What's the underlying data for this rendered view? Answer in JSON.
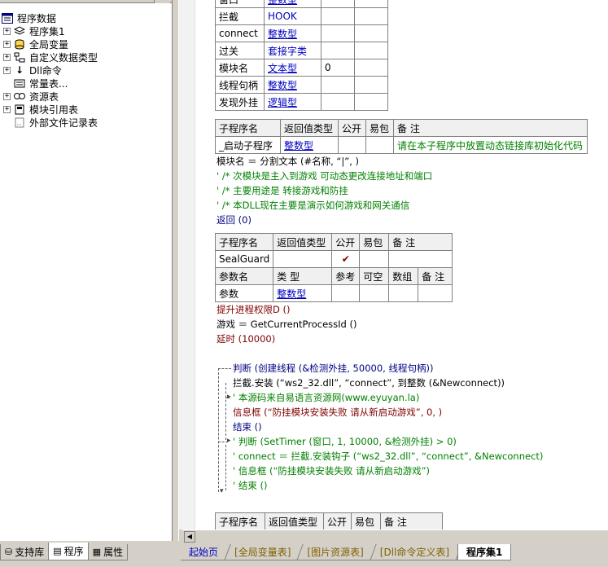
{
  "left_tree": {
    "root": "程序数据",
    "items": [
      {
        "label": "程序集1",
        "icon": "assembly-icon"
      },
      {
        "label": "全局变量",
        "icon": "global-var-icon"
      },
      {
        "label": "自定义数据类型",
        "icon": "datatype-icon"
      },
      {
        "label": "Dll命令",
        "icon": "dll-icon"
      },
      {
        "label": "常量表...",
        "icon": "constant-icon"
      },
      {
        "label": "资源表",
        "icon": "resource-icon"
      },
      {
        "label": "模块引用表",
        "icon": "module-icon"
      },
      {
        "label": "外部文件记录表",
        "icon": "file-icon"
      }
    ]
  },
  "left_tabs": [
    "支持库",
    "程序",
    "属性"
  ],
  "var_table": [
    {
      "name": "窗口",
      "type": "整数型",
      "val": ""
    },
    {
      "name": "拦截",
      "type": "HOOK",
      "val": ""
    },
    {
      "name": "connect",
      "type": "整数型",
      "val": ""
    },
    {
      "name": "过关",
      "type": "套接字类",
      "val": ""
    },
    {
      "name": "模块名",
      "type": "文本型",
      "val": "0"
    },
    {
      "name": "线程句柄",
      "type": "整数型",
      "val": ""
    },
    {
      "name": "发现外挂",
      "type": "逻辑型",
      "val": ""
    }
  ],
  "sub1": {
    "headers": [
      "子程序名",
      "返回值类型",
      "公开",
      "易包",
      "备 注"
    ],
    "name": "_启动子程序",
    "ret": "整数型",
    "note": "请在本子程序中放置动态链接库初始化代码"
  },
  "code1": {
    "l1": "模块名 ＝ 分割文本 (#名称, “|”, )",
    "l2": "' /* 次模块是主入到游戏 可动态更改连接地址和端口",
    "l3": "' /* 主要用途是 转接游戏和防挂",
    "l4": "' /* 本DLL现在主要是演示如何游戏和网关通信",
    "l5": "返回 (0)"
  },
  "sub2": {
    "headers": [
      "子程序名",
      "返回值类型",
      "公开",
      "易包",
      "备 注"
    ],
    "name": "SealGuard",
    "check": "✔",
    "param_headers": [
      "参数名",
      "类 型",
      "参考",
      "可空",
      "数组",
      "备 注"
    ],
    "param_name": "参数",
    "param_type": "整数型"
  },
  "code2": {
    "l1": "提升进程权限D ()",
    "l2": "游戏 ＝ GetCurrentProcessId ()",
    "l3": "延时 (10000)",
    "l4": "判断 (创建线程 (&检测外挂, 50000, 线程句柄))",
    "l5": "拦截.安装 (“ws2_32.dll”, “connect”, 到整数 (&Newconnect))",
    "l6": "' 本源码来自易语言资源网(www.eyuyan.la)",
    "l7": "信息框 (“防挂模块安装失败 请从新启动游戏”, 0, )",
    "l8": "结束 ()",
    "l9": "' 判断 (SetTimer (窗口, 1, 10000, &检测外挂) > 0)",
    "l10": "' connect ＝ 拦截.安装钩子 (“ws2_32.dll”, “connect”, &Newconnect)",
    "l11": "' 信息框 (“防挂模块安装失败 请从新启动游戏”)",
    "l12": "' 结束 ()"
  },
  "sub3_headers": [
    "子程序名",
    "返回值类型",
    "公开",
    "易包",
    "备 注"
  ],
  "code_tabs": [
    "起始页",
    "[全局变量表]",
    "[图片资源表]",
    "[Dll命令定义表]",
    "程序集1"
  ]
}
